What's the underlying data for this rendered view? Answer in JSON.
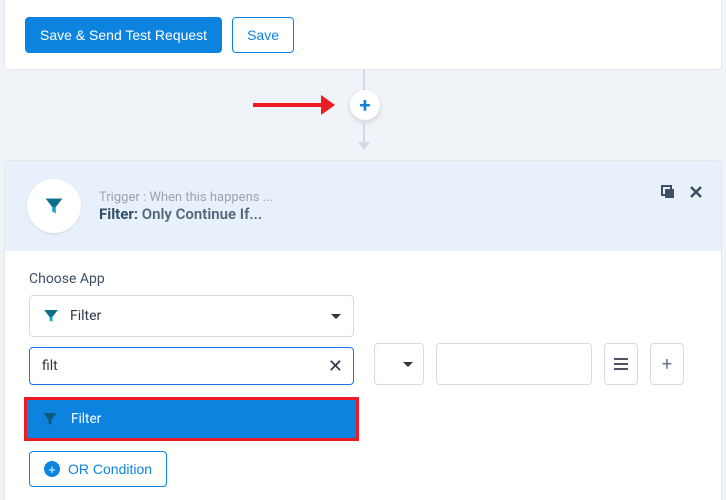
{
  "toolbar": {
    "save_send_label": "Save & Send Test Request",
    "save_label": "Save"
  },
  "add_step": {
    "icon": "plus-icon"
  },
  "card": {
    "trigger_line": "Trigger : When this happens ...",
    "filter_prefix": "Filter:",
    "filter_desc": " Only Continue If..."
  },
  "choose_app": {
    "label": "Choose App",
    "selected": "Filter",
    "search_value": "filt",
    "options": [
      {
        "label": "Filter",
        "icon": "funnel-icon"
      }
    ]
  },
  "or_condition": {
    "label": "OR Condition"
  }
}
